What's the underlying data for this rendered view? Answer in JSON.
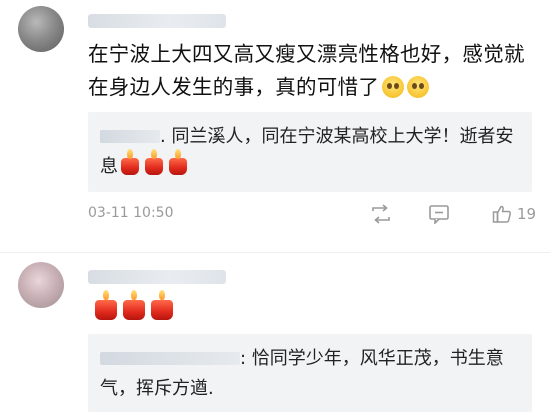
{
  "comment1": {
    "text": "在宁波上大四又高又瘦又漂亮性格也好，感觉就在身边人发生的事，真的可惜了",
    "emojis": [
      "sad-face-emoji",
      "sad-face-emoji"
    ],
    "reply": {
      "text": ". 同兰溪人，同在宁波某高校上大学！逝者安息",
      "emojis": [
        "candle-emoji",
        "candle-emoji",
        "candle-emoji"
      ]
    },
    "time": "03-11 10:50",
    "likes": "19"
  },
  "comment2": {
    "emojis": [
      "candle-emoji",
      "candle-emoji",
      "candle-emoji"
    ],
    "reply": {
      "text": ": 恰同学少年，风华正茂，书生意气，挥斥方遒."
    }
  },
  "icons": {
    "share": "share-icon",
    "comment": "comment-icon",
    "like": "like-icon"
  },
  "colors": {
    "meta_gray": "#9a9a9a",
    "reply_bg": "#f2f3f5",
    "text": "#111111"
  }
}
